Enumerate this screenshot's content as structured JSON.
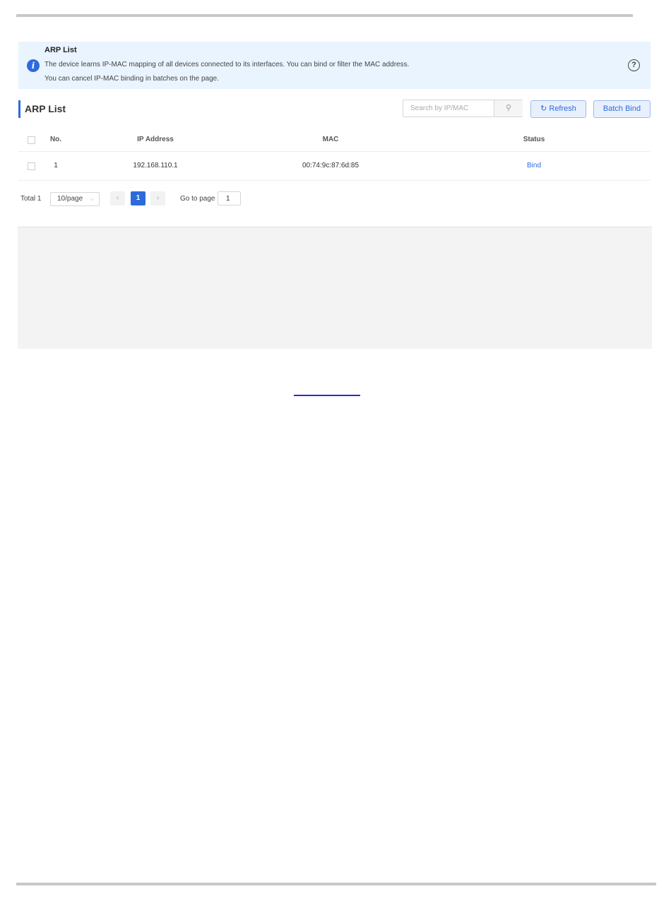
{
  "banner": {
    "title": "ARP List",
    "line1": "The device learns IP-MAC mapping of all devices connected to its interfaces. You can bind or filter the MAC address.",
    "line2": "You can cancel IP-MAC binding in batches on the page.",
    "info_icon_glyph": "i",
    "help_icon_glyph": "?"
  },
  "section": {
    "title": "ARP List"
  },
  "search": {
    "placeholder": "Search by IP/MAC",
    "value": "",
    "icon_glyph": "⚲"
  },
  "toolbar": {
    "refresh_label": "Refresh",
    "refresh_icon_glyph": "↻",
    "batch_bind_label": "Batch Bind"
  },
  "table": {
    "headers": {
      "no": "No.",
      "ip": "IP Address",
      "mac": "MAC",
      "status": "Status"
    },
    "rows": [
      {
        "no": "1",
        "ip": "192.168.110.1",
        "mac": "00:74:9c:87:6d:85",
        "status": "Bind"
      }
    ]
  },
  "pagination": {
    "total": "Total 1",
    "page_size": "10/page",
    "current_page": "1",
    "goto_label": "Go to page",
    "goto_value": "1",
    "prev_glyph": "‹",
    "next_glyph": "›",
    "dropdown_glyph": "⌵"
  },
  "colors": {
    "accent": "#2d6bdc",
    "banner_bg": "#e9f4fe",
    "panel_bg": "#f3f3f3"
  }
}
